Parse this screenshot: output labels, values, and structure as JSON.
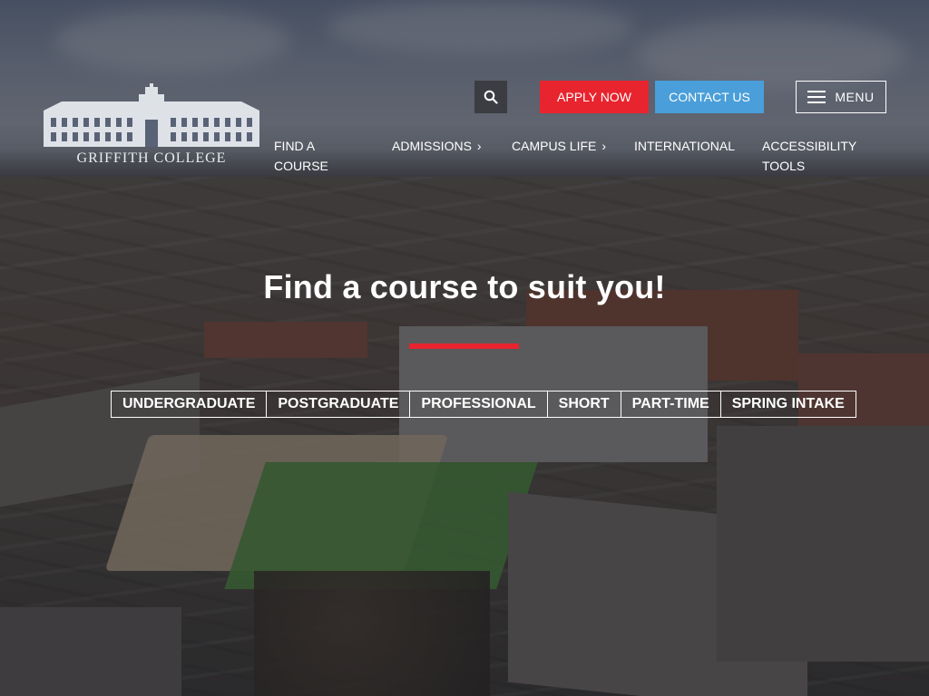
{
  "brand": {
    "logo_icon": "college-building-logo",
    "name": "GRIFFITH COLLEGE"
  },
  "header": {
    "search_icon": "search-icon",
    "apply_label": "APPLY NOW",
    "contact_label": "CONTACT US",
    "menu_label": "MENU",
    "menu_icon": "hamburger-icon"
  },
  "nav": {
    "items": [
      {
        "label": "FIND A COURSE",
        "has_chevron": false
      },
      {
        "label": "ADMISSIONS",
        "has_chevron": true
      },
      {
        "label": "CAMPUS LIFE",
        "has_chevron": true
      },
      {
        "label": "INTERNATIONAL",
        "has_chevron": false
      },
      {
        "label": "ACCESSIBILITY TOOLS",
        "has_chevron": false
      }
    ]
  },
  "hero": {
    "headline": "Find a course to suit you!",
    "tabs": [
      "UNDERGRADUATE",
      "POSTGRADUATE",
      "PROFESSIONAL",
      "SHORT",
      "PART-TIME",
      "SPRING INTAKE"
    ]
  },
  "colors": {
    "apply": "#e8242e",
    "contact": "#4a9ed9",
    "search_bg": "#3b3d42",
    "accent_underline": "#e8242e"
  }
}
